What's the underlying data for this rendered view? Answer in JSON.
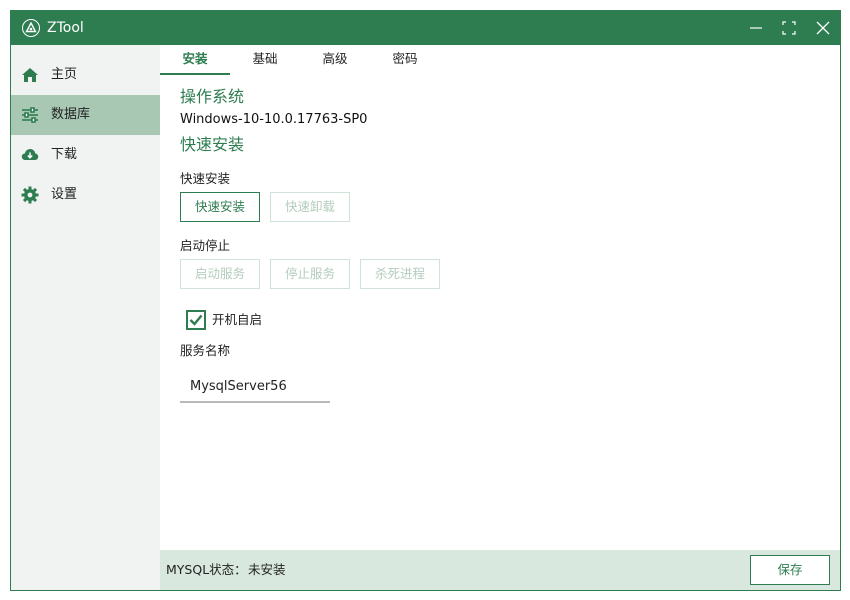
{
  "window": {
    "title": "ZTool",
    "accent_color": "#2e7d50",
    "icons": [
      "app-logo-icon",
      "minimize-icon",
      "maximize-icon",
      "close-icon"
    ]
  },
  "sidebar": {
    "items": [
      {
        "label": "主页",
        "icon": "home-icon",
        "active": false
      },
      {
        "label": "数据库",
        "icon": "sliders-icon",
        "active": true
      },
      {
        "label": "下载",
        "icon": "cloud-download-icon",
        "active": false
      },
      {
        "label": "设置",
        "icon": "gear-icon",
        "active": false
      }
    ]
  },
  "tabs": [
    {
      "label": "安装",
      "active": true
    },
    {
      "label": "基础",
      "active": false
    },
    {
      "label": "高级",
      "active": false
    },
    {
      "label": "密码",
      "active": false
    }
  ],
  "main": {
    "os_heading": "操作系统",
    "os_value": "Windows-10-10.0.17763-SP0",
    "quick_heading": "快速安装",
    "quick_install_label": "快速安装",
    "install_button": "快速安装",
    "uninstall_button": "快速卸载",
    "start_stop_label": "启动停止",
    "start_service_button": "启动服务",
    "stop_service_button": "停止服务",
    "kill_process_button": "杀死进程",
    "autostart_label": "开机自启",
    "autostart_checked": true,
    "service_name_label": "服务名称",
    "service_name_value": "MysqlServer56"
  },
  "statusbar": {
    "label": "MYSQL状态：",
    "value": "未安装",
    "save_button": "保存"
  }
}
